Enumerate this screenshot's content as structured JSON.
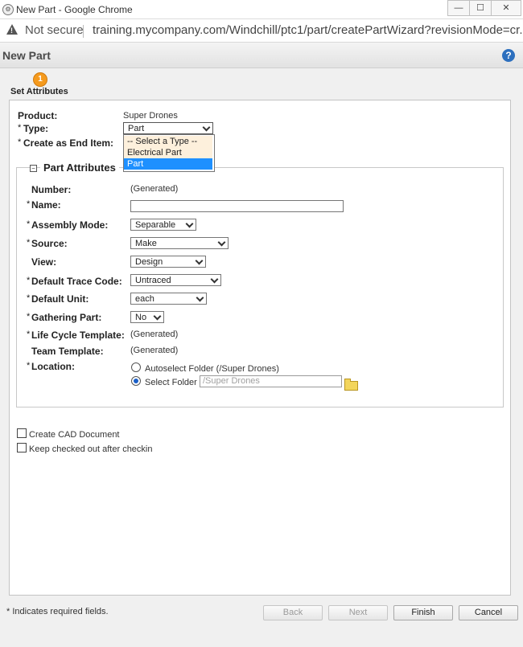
{
  "window": {
    "title": "New Part - Google Chrome",
    "min_glyph": "—",
    "max_glyph": "☐",
    "close_glyph": "✕",
    "app_icon_glyph": "⚙"
  },
  "addressbar": {
    "security_text": "Not secure",
    "url": "training.mycompany.com/Windchill/ptc1/part/createPartWizard?revisionMode=cr...",
    "warn_glyph": "!"
  },
  "header": {
    "title": "New Part",
    "help_glyph": "?"
  },
  "wizard": {
    "step_number": "1",
    "step_label": "Set Attributes"
  },
  "form": {
    "req_marker": "*",
    "product_label": "Product:",
    "product_value": "Super Drones",
    "type_label": "Type:",
    "type_selected": "Part",
    "type_options": [
      "-- Select a Type --",
      "Electrical Part",
      "Part"
    ],
    "end_item_label": "Create as End Item:",
    "attributes_legend": "Part Attributes",
    "collapse_glyph": "−",
    "number_label": "Number:",
    "number_value": "(Generated)",
    "name_label": "Name:",
    "name_value": "",
    "assembly_label": "Assembly Mode:",
    "assembly_value": "Separable",
    "source_label": "Source:",
    "source_value": "Make",
    "view_label": "View:",
    "view_value": "Design",
    "trace_label": "Default Trace Code:",
    "trace_value": "Untraced",
    "unit_label": "Default Unit:",
    "unit_value": "each",
    "gathering_label": "Gathering Part:",
    "gathering_value": "No",
    "lifecycle_label": "Life Cycle Template:",
    "lifecycle_value": "(Generated)",
    "team_label": "Team Template:",
    "team_value": "(Generated)",
    "location_label": "Location:",
    "autoselect_label": "Autoselect Folder (/Super Drones)",
    "select_folder_label": "Select Folder",
    "folder_value": "/Super Drones"
  },
  "options": {
    "create_cad_label": "Create CAD Document",
    "keep_checked_label": "Keep checked out after checkin"
  },
  "footer": {
    "required_note": "* Indicates required fields.",
    "back_label": "Back",
    "next_label": "Next",
    "finish_label": "Finish",
    "cancel_label": "Cancel"
  },
  "colors": {
    "accent_selected": "#1e90ff",
    "dropdown_highlight": "#fdf0dc",
    "step_orange": "#f59a1d",
    "help_blue": "#2c6fbe"
  }
}
